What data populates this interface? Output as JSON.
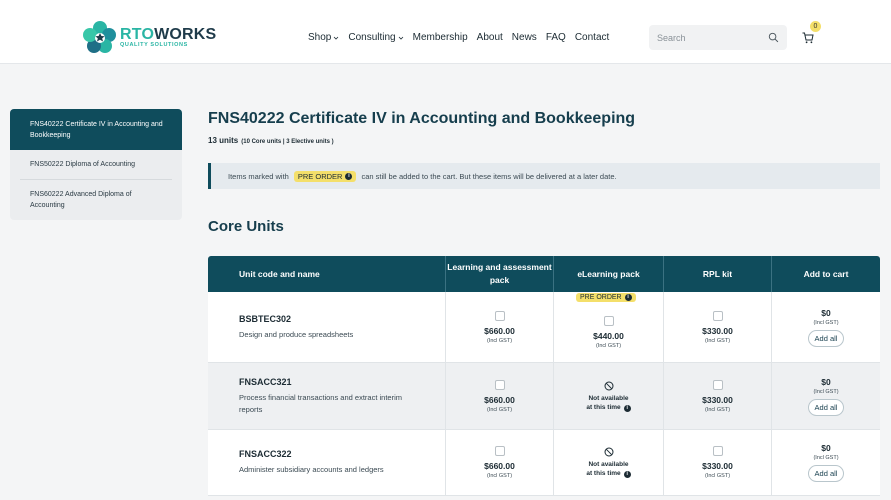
{
  "header": {
    "logo_name_left": "RTO",
    "logo_name_right": "WORKS",
    "logo_sub": "QUALITY SOLUTIONS",
    "nav": [
      "Shop",
      "Consulting",
      "Membership",
      "About",
      "News",
      "FAQ",
      "Contact"
    ],
    "search_placeholder": "Search",
    "cart_count": "0"
  },
  "sidebar": {
    "items": [
      "FNS40222 Certificate IV in Accounting and Bookkeeping",
      "FNS50222 Diploma of Accounting",
      "FNS60222 Advanced Diploma of Accounting"
    ]
  },
  "main": {
    "title": "FNS40222 Certificate IV in Accounting and Bookkeeping",
    "units_total": "13 units",
    "units_breakdown": "(10 Core units | 3 Elective units )",
    "notice_before": "Items marked with",
    "notice_badge": "PRE ORDER",
    "notice_after": "can still be added to the cart. But these items will be delivered at a later date.",
    "section_title": "Core Units"
  },
  "table": {
    "headers": [
      "Unit code and name",
      "Learning and assessment pack",
      "eLearning pack",
      "RPL kit",
      "Add to cart"
    ],
    "pre_order_label": "PRE ORDER",
    "not_available_line1": "Not available",
    "not_available_line2": "at this time",
    "gst_label": "(Incl GST)",
    "add_all_label": "Add all",
    "rows": [
      {
        "code": "BSBTEC302",
        "name": "Design and produce spreadsheets",
        "lap_price": "$660.00",
        "elearning_price": "$440.00",
        "rpl_price": "$330.00",
        "cart_total": "$0"
      },
      {
        "code": "FNSACC321",
        "name": "Process financial transactions and extract interim reports",
        "lap_price": "$660.00",
        "elearning_price": "",
        "rpl_price": "$330.00",
        "cart_total": "$0"
      },
      {
        "code": "FNSACC322",
        "name": "Administer subsidiary accounts and ledgers",
        "lap_price": "$660.00",
        "elearning_price": "",
        "rpl_price": "$330.00",
        "cart_total": "$0"
      }
    ]
  }
}
